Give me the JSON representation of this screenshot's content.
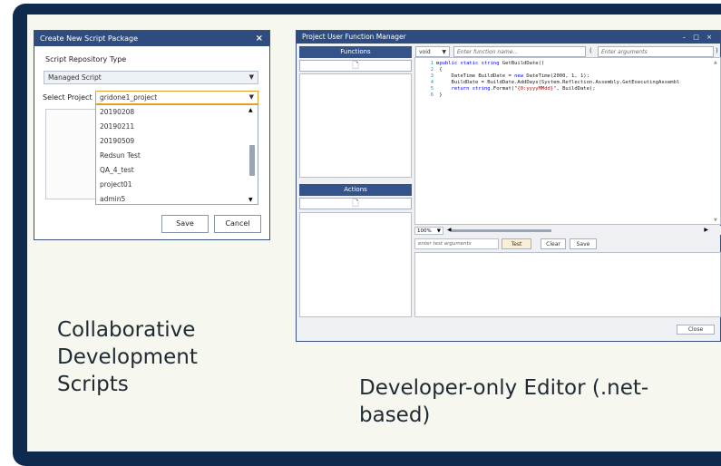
{
  "dialog1": {
    "title": "Create New Script Package",
    "close_glyph": "×",
    "repo_type_label": "Script Repository Type",
    "repo_type_value": "Managed Script",
    "project_label": "Select Project :",
    "project_value": "gridone1_project",
    "project_options": [
      "20190208",
      "20190211",
      "20190509",
      "Redsun Test",
      "QA_4_test",
      "project01",
      "admin5"
    ],
    "save_label": "Save",
    "cancel_label": "Cancel"
  },
  "dialog2": {
    "title": "Project User Function Manager",
    "window_controls": "– □ ×",
    "functions_header": "Functions",
    "actions_header": "Actions",
    "return_type": "void",
    "function_name_placeholder": "Enter function name...",
    "paren_open": "(",
    "arguments_placeholder": "Enter arguments",
    "paren_close": ")",
    "code_line_numbers": [
      "1",
      "2",
      "3",
      "4",
      "5",
      "6"
    ],
    "zoom": "100%",
    "test_args_placeholder": "enter test arguments",
    "test_label": "Test",
    "clear_label": "Clear",
    "save_label": "Save",
    "close_label": "Close"
  },
  "captions": {
    "left": "Collaborative Development Scripts",
    "right": "Developer-only Editor (.net-based)"
  },
  "colors": {
    "frame": "#0f2a4f",
    "titlebar": "#2f4c7e",
    "panel_header": "#34538a",
    "keyword": "#0000ff",
    "string": "#a31515"
  }
}
